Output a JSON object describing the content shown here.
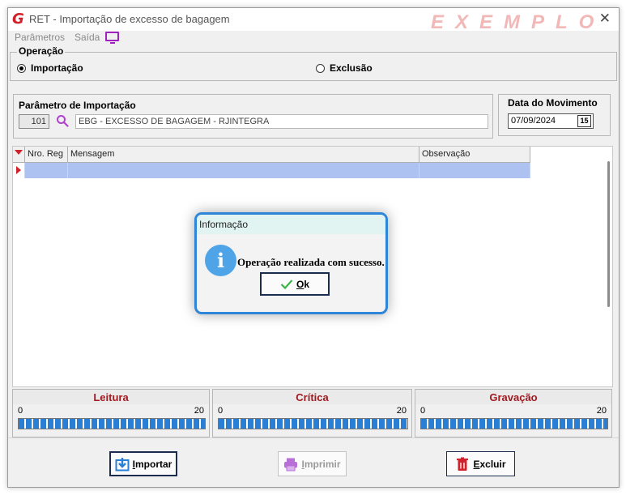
{
  "window": {
    "title": "RET - Importação de excesso de bagagem",
    "app_icon": "G",
    "watermark": "EXEMPLO",
    "close_glyph": "✕"
  },
  "menu": {
    "items": [
      "Parâmetros",
      "Saída"
    ],
    "monitor_icon": "monitor-icon"
  },
  "operacao": {
    "legend": "Operação",
    "options": [
      {
        "label": "Importação",
        "checked": true
      },
      {
        "label": "Exclusão",
        "checked": false
      }
    ]
  },
  "parametro": {
    "legend": "Parâmetro de Importação",
    "code": "101",
    "description": "EBG - EXCESSO DE BAGAGEM - RJINTEGRA"
  },
  "data_movimento": {
    "legend": "Data do Movimento",
    "value": "07/09/2024",
    "calendar_label": "15"
  },
  "grid": {
    "columns": [
      "Nro. Reg",
      "Mensagem",
      "Observação"
    ],
    "rows": [
      [
        "",
        "",
        ""
      ]
    ]
  },
  "progress": [
    {
      "title": "Leitura",
      "min": "0",
      "max": "20",
      "fill": 1.0
    },
    {
      "title": "Crítica",
      "min": "0",
      "max": "20",
      "fill": 1.0
    },
    {
      "title": "Gravação",
      "min": "0",
      "max": "20",
      "fill": 1.0
    }
  ],
  "buttons": {
    "importar": {
      "underline": "I",
      "rest": "mportar"
    },
    "imprimir": {
      "underline": "I",
      "rest": "mprimir"
    },
    "excluir": {
      "underline": "E",
      "rest": "xcluir"
    }
  },
  "dialog": {
    "title": "Informação",
    "message": "Operação realizada com sucesso.",
    "ok_underline": "O",
    "ok_rest": "k",
    "info_glyph": "i"
  },
  "colors": {
    "accent_red": "#d0222a",
    "progress_blue": "#2a7fd4",
    "dialog_border": "#2f86d8",
    "selected_row": "#aec2f1"
  }
}
